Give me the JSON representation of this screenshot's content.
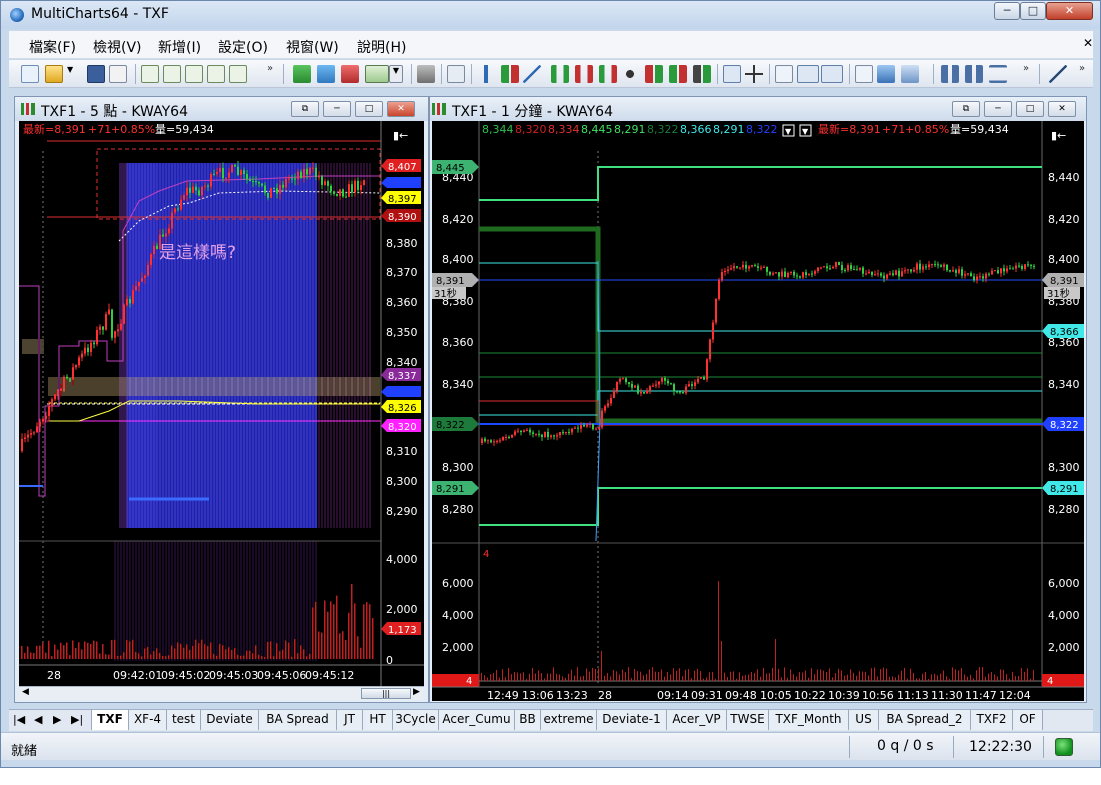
{
  "app": {
    "title": "MultiCharts64 - TXF",
    "win_min": "─",
    "win_max": "□",
    "win_close": "✕"
  },
  "menu": [
    "檔案(F)",
    "檢視(V)",
    "新增(I)",
    "設定(O)",
    "視窗(W)",
    "說明(H)"
  ],
  "mdi_close": "✕",
  "left_chart": {
    "window_title": "TXF1 - 5 點 - KWAY64",
    "info": {
      "last": "最新=8,391",
      "change": "+71",
      "pct": "+0.85%",
      "volume": "量=59,434"
    },
    "annotation": "是這樣嗎?",
    "price_ticks": [
      "8,380",
      "8,370",
      "8,360",
      "8,350",
      "8,340",
      "8,310",
      "8,300",
      "8,290"
    ],
    "price_tags": [
      {
        "text": "8,407",
        "color": "#e02020"
      },
      {
        "text": "8,397",
        "color": "#ffff00"
      },
      {
        "text": "8,390",
        "color": "#b01010"
      },
      {
        "text": "8,337",
        "color": "#8a2a9a"
      },
      {
        "text": "8,326",
        "color": "#ffff00"
      },
      {
        "text": "8,320",
        "color": "#ff20ff"
      }
    ],
    "volume_ticks": [
      "4,000",
      "2,000",
      "0"
    ],
    "volume_tag": "1,173",
    "time_labels": [
      "28",
      "09:42:01",
      "09:45:02",
      "09:45:03",
      "09:45:06",
      "09:45:12"
    ]
  },
  "right_chart": {
    "window_title": "TXF1 - 1 分鐘 - KWAY64",
    "ohlc": [
      {
        "text": "8,344",
        "color": "#2fbf4f"
      },
      {
        "text": "8,320",
        "color": "#d02020"
      },
      {
        "text": "8,334",
        "color": "#e03030"
      },
      {
        "text": "8,445",
        "color": "#40e060"
      },
      {
        "text": "8,291",
        "color": "#40e060"
      },
      {
        "text": "8,322",
        "color": "#1e7a3a"
      },
      {
        "text": "8,366",
        "color": "#40e8e8"
      },
      {
        "text": "8,291",
        "color": "#40e8e8"
      },
      {
        "text": "8,322",
        "color": "#2040ff"
      }
    ],
    "info": {
      "last": "最新=8,391",
      "change": "+71",
      "pct": "+0.85%",
      "volume": "量=59,434"
    },
    "price_ticks": [
      "8,440",
      "8,420",
      "8,400",
      "8,380",
      "8,360",
      "8,340",
      "8,300",
      "8,280"
    ],
    "left_tags": [
      {
        "text": "8,445",
        "color": "#3cb371"
      },
      {
        "text": "8,391",
        "color": "#b0b0b0"
      },
      {
        "text": "8,322",
        "color": "#1e7a3a"
      },
      {
        "text": "8,291",
        "color": "#3cb371"
      }
    ],
    "right_tags": [
      {
        "text": "8,391",
        "color": "#b0b0b0"
      },
      {
        "text": "8,366",
        "color": "#40e8e8"
      },
      {
        "text": "8,322",
        "color": "#2040ff"
      },
      {
        "text": "8,291",
        "color": "#40e8e8"
      }
    ],
    "countdown": "31秒",
    "volume_ticks": [
      "6,000",
      "4,000",
      "2,000"
    ],
    "volume_marker": "4",
    "time_labels": [
      "12:49",
      "13:06",
      "13:23",
      "28",
      "09:14",
      "09:31",
      "09:48",
      "10:05",
      "10:22",
      "10:39",
      "10:56",
      "11:13",
      "11:30",
      "11:47",
      "12:04"
    ]
  },
  "tabs": [
    "TXF",
    "XF-4",
    "test",
    "Deviate",
    "BA Spread",
    "JT",
    "HT",
    "3Cycle",
    "Acer_Cumu",
    "BB",
    "extreme",
    "Deviate-1",
    "Acer_VP",
    "TWSE",
    "TXF_Month",
    "US",
    "BA Spread_2",
    "TXF2",
    "OF"
  ],
  "active_tab": "TXF",
  "status": {
    "text": "就緒",
    "orders": "0 q / 0 s",
    "clock": "12:22:30"
  }
}
